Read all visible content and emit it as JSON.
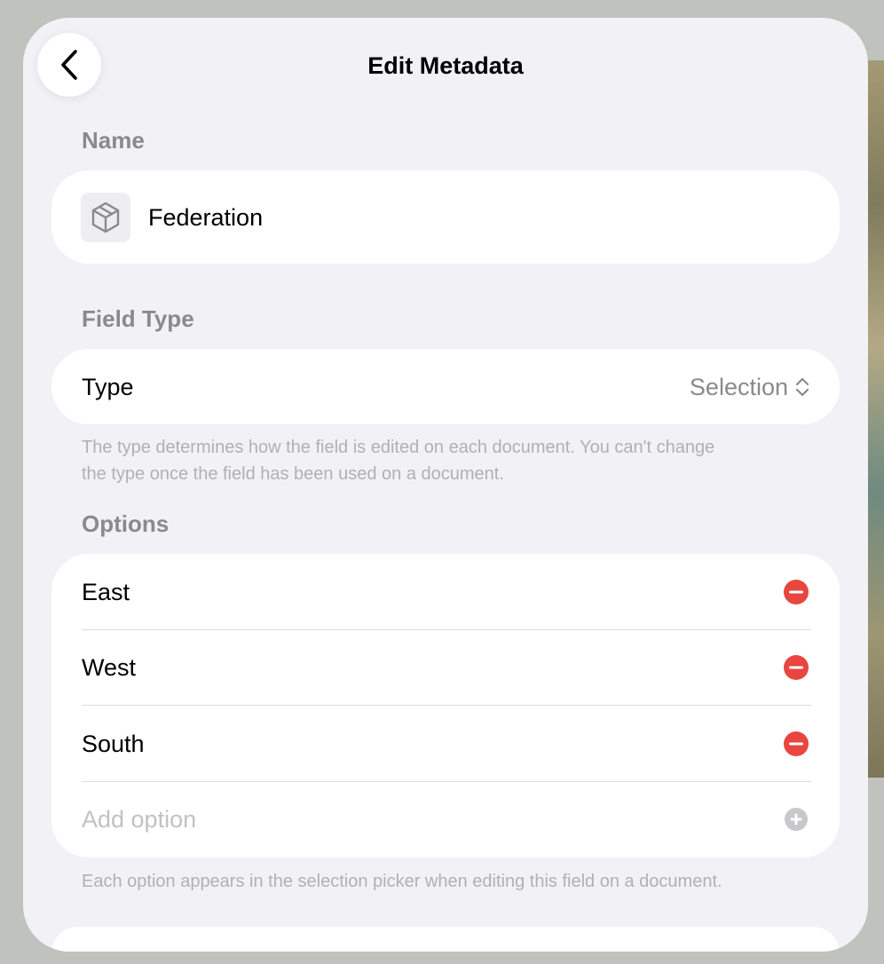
{
  "header": {
    "title": "Edit Metadata"
  },
  "name_section": {
    "label": "Name",
    "icon": "cube-icon",
    "value": "Federation"
  },
  "field_type_section": {
    "label": "Field Type",
    "type_label": "Type",
    "type_value": "Selection",
    "footnote_line1": "The type determines how the field is edited on each document. You can't change",
    "footnote_line2": "the type once the field has been used on a document."
  },
  "options_section": {
    "label": "Options",
    "items": [
      {
        "label": "East"
      },
      {
        "label": "West"
      },
      {
        "label": "South"
      }
    ],
    "add_placeholder": "Add option",
    "footnote": "Each option appears in the selection picker when editing this field on a document."
  },
  "colors": {
    "remove": "#e8463e",
    "add": "#c7c7cc",
    "sheet_background": "#f1f1f6"
  }
}
